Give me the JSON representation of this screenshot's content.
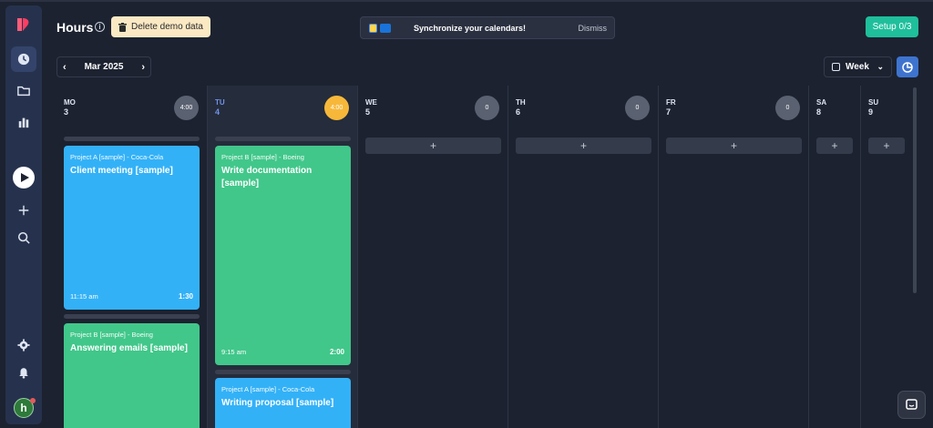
{
  "header": {
    "title": "Hours",
    "delete_demo_label": "Delete demo data",
    "sync_text": "Synchronize your calendars!",
    "dismiss_label": "Dismiss",
    "setup_label": "Setup 0/3"
  },
  "toolbar": {
    "month": "Mar 2025",
    "view": "Week"
  },
  "user": {
    "initial": "h"
  },
  "days": [
    {
      "abbr": "MO",
      "num": "3",
      "total": "4:00"
    },
    {
      "abbr": "TU",
      "num": "4",
      "total": "4:00"
    },
    {
      "abbr": "WE",
      "num": "5",
      "total": "0"
    },
    {
      "abbr": "TH",
      "num": "6",
      "total": "0"
    },
    {
      "abbr": "FR",
      "num": "7",
      "total": "0"
    },
    {
      "abbr": "SA",
      "num": "8"
    },
    {
      "abbr": "SU",
      "num": "9"
    }
  ],
  "add_label": "+",
  "events": [
    {
      "project": "Project A [sample] - Coca-Cola",
      "title": "Client meeting [sample]",
      "time": "11:15 am",
      "duration": "1:30"
    },
    {
      "project": "Project B [sample] - Boeing",
      "title": "Answering emails [sample]"
    },
    {
      "project": "Project B [sample] - Boeing",
      "title": "Write documentation [sample]",
      "time": "9:15 am",
      "duration": "2:00"
    },
    {
      "project": "Project A [sample] - Coca-Cola",
      "title": "Writing proposal [sample]"
    }
  ],
  "colors": {
    "blue_event": "#33b1f7",
    "green_event": "#41c78a",
    "today": "#6f93ea",
    "setup": "#1fbf9c",
    "badge_today": "#f7b83a"
  },
  "icons": [
    "logo-icon",
    "clock-icon",
    "folder-icon",
    "bar-chart-icon",
    "play-icon",
    "plus-icon",
    "search-icon",
    "gear-icon",
    "bell-icon",
    "info-icon",
    "trash-icon",
    "google-calendar-icon",
    "outlook-icon",
    "chevron-left-icon",
    "chevron-right-icon",
    "calendar-icon",
    "chevron-down-icon",
    "pie-chart-icon",
    "chat-icon"
  ]
}
